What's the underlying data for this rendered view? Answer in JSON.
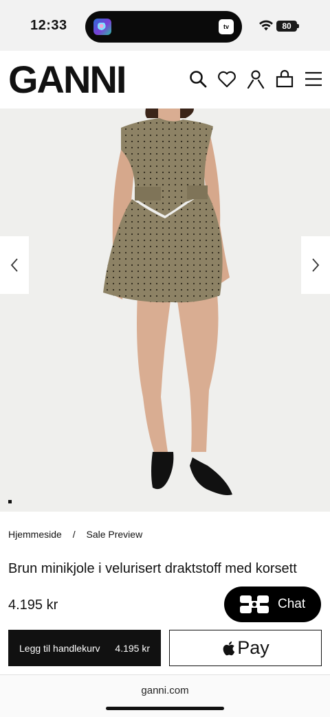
{
  "status_bar": {
    "time": "12:33",
    "battery": "80",
    "island_app_label": "tv"
  },
  "header": {
    "logo": "GANNI",
    "icons": [
      "search-icon",
      "heart-icon",
      "account-icon",
      "bag-icon",
      "menu-icon"
    ]
  },
  "product": {
    "breadcrumb": [
      "Hjemmeside",
      "/",
      "Sale Preview"
    ],
    "title": "Brun minikjole i velurisert draktstoff med korsett",
    "price": "4.195 kr"
  },
  "actions": {
    "add_to_cart_label": "Legg til handlekurv",
    "add_to_cart_price": "4.195 kr",
    "apple_pay_label": "Pay",
    "chat_label": "Chat"
  },
  "browser": {
    "url": "ganni.com"
  },
  "colors": {
    "accent": "#000000",
    "hero_background": "#efefed",
    "dress": "#8d8265"
  }
}
